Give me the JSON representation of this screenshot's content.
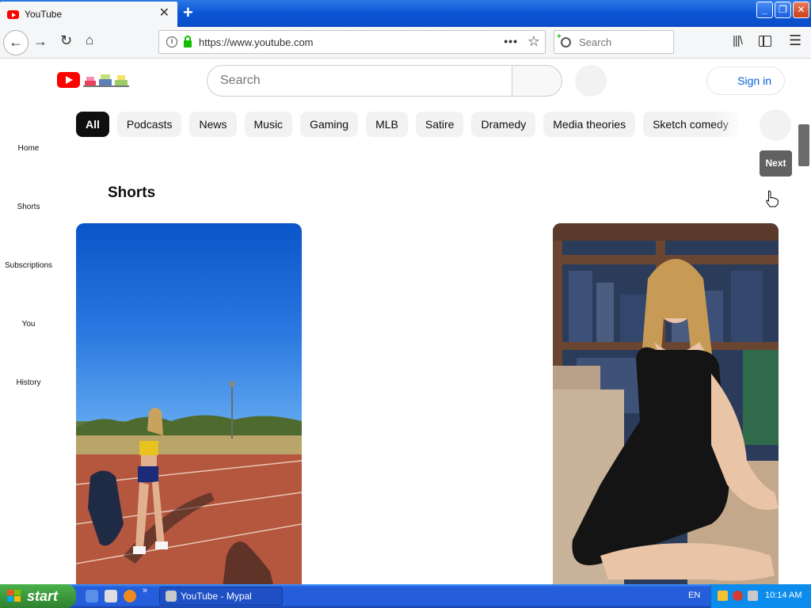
{
  "browser": {
    "tab_title": "YouTube",
    "url": "https://www.youtube.com",
    "search_placeholder": "Search",
    "page_actions_label": "•••"
  },
  "youtube": {
    "search_placeholder": "Search",
    "sign_in_label": "Sign in",
    "chips": [
      "All",
      "Podcasts",
      "News",
      "Music",
      "Gaming",
      "MLB",
      "Satire",
      "Dramedy",
      "Media theories",
      "Sketch comedy"
    ],
    "active_chip": "All",
    "next_tooltip": "Next",
    "guide": [
      "Home",
      "Shorts",
      "Subscriptions",
      "You",
      "History"
    ],
    "section_title": "Shorts"
  },
  "taskbar": {
    "start_label": "start",
    "task_label": "YouTube - Mypal",
    "language": "EN",
    "clock": "10:14 AM"
  },
  "colors": {
    "brand_red": "#ff0000",
    "link_blue": "#065fd4",
    "chip_active": "#0f0f0f",
    "xp_taskbar": "#245edb",
    "xp_start": "#3c9a3c"
  }
}
